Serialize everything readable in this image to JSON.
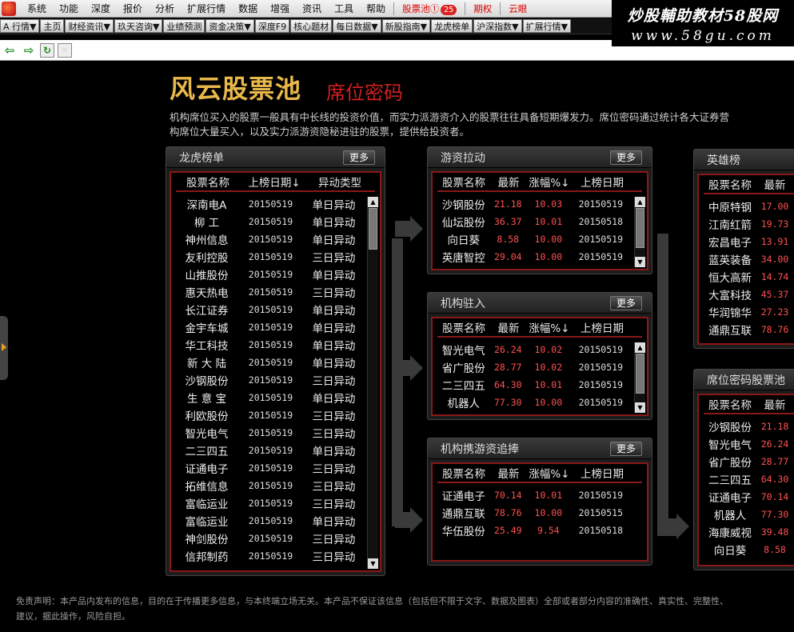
{
  "menubar": {
    "items": [
      "系统",
      "功能",
      "深度",
      "报价",
      "分析",
      "扩展行情",
      "数据",
      "增强",
      "资讯",
      "工具",
      "帮助"
    ],
    "stock_pool": "股票池",
    "stock_pool_num": "①",
    "stock_pool_badge": "25",
    "qiquan": "期权",
    "yunyan": "云眼"
  },
  "watermark": {
    "line1": "炒股輔助教材58股网",
    "line2": "www.58gu.com"
  },
  "tabs": [
    "A 行情▼",
    "主页",
    "财经资讯▼",
    "玖天咨询▼",
    "业绩预测",
    "资金决策▼",
    "深度F9",
    "核心题材",
    "每日数据▼",
    "新股指南▼",
    "龙虎榜单",
    "沪深指数▼",
    "扩展行情▼"
  ],
  "header": {
    "title": "风云股票池",
    "subtitle": "席位密码",
    "intro_line1": "机构席位买入的股票一般具有中长线的投资价值，而实力派游资介入的股票往往具备短期爆发力。席位密码通过统计各大证券营",
    "intro_line2": "构席位大量买入，以及实力派游资隐秘进驻的股票，提供给投资者。"
  },
  "more_label": "更多",
  "longhu": {
    "title": "龙虎榜单",
    "cols": [
      "股票名称",
      "上榜日期↓",
      "异动类型"
    ],
    "rows": [
      [
        "深南电A",
        "20150519",
        "单日异动"
      ],
      [
        "柳 工",
        "20150519",
        "单日异动"
      ],
      [
        "神州信息",
        "20150519",
        "单日异动"
      ],
      [
        "友利控股",
        "20150519",
        "三日异动"
      ],
      [
        "山推股份",
        "20150519",
        "单日异动"
      ],
      [
        "惠天热电",
        "20150519",
        "三日异动"
      ],
      [
        "长江证券",
        "20150519",
        "单日异动"
      ],
      [
        "金宇车城",
        "20150519",
        "单日异动"
      ],
      [
        "华工科技",
        "20150519",
        "单日异动"
      ],
      [
        "新 大 陆",
        "20150519",
        "单日异动"
      ],
      [
        "沙钢股份",
        "20150519",
        "三日异动"
      ],
      [
        "生 意 宝",
        "20150519",
        "单日异动"
      ],
      [
        "利欧股份",
        "20150519",
        "三日异动"
      ],
      [
        "智光电气",
        "20150519",
        "三日异动"
      ],
      [
        "二三四五",
        "20150519",
        "单日异动"
      ],
      [
        "证通电子",
        "20150519",
        "三日异动"
      ],
      [
        "拓维信息",
        "20150519",
        "三日异动"
      ],
      [
        "富临运业",
        "20150519",
        "三日异动"
      ],
      [
        "富临运业",
        "20150519",
        "单日异动"
      ],
      [
        "神剑股份",
        "20150519",
        "三日异动"
      ],
      [
        "信邦制药",
        "20150519",
        "三日异动"
      ]
    ]
  },
  "youzi": {
    "title": "游资拉动",
    "cols": [
      "股票名称",
      "最新",
      "涨幅%↓",
      "上榜日期"
    ],
    "rows": [
      [
        "沙钢股份",
        "21.18",
        "10.03",
        "20150519"
      ],
      [
        "仙坛股份",
        "36.37",
        "10.01",
        "20150518"
      ],
      [
        "向日葵",
        "8.58",
        "10.00",
        "20150519"
      ],
      [
        "英唐智控",
        "29.04",
        "10.00",
        "20150519"
      ]
    ]
  },
  "jigou": {
    "title": "机构驻入",
    "cols": [
      "股票名称",
      "最新",
      "涨幅%↓",
      "上榜日期"
    ],
    "rows": [
      [
        "智光电气",
        "26.24",
        "10.02",
        "20150519"
      ],
      [
        "省广股份",
        "28.77",
        "10.02",
        "20150519"
      ],
      [
        "二三四五",
        "64.30",
        "10.01",
        "20150519"
      ],
      [
        "机器人",
        "77.30",
        "10.00",
        "20150519"
      ]
    ]
  },
  "xieyou": {
    "title": "机构携游资追捧",
    "cols": [
      "股票名称",
      "最新",
      "涨幅%↓",
      "上榜日期"
    ],
    "rows": [
      [
        "证通电子",
        "70.14",
        "10.01",
        "20150519"
      ],
      [
        "通鼎互联",
        "78.76",
        "10.00",
        "20150515"
      ],
      [
        "华伍股份",
        "25.49",
        "9.54",
        "20150518"
      ]
    ]
  },
  "yingxiong": {
    "title": "英雄榜",
    "cols": [
      "股票名称",
      "最新"
    ],
    "rows": [
      [
        "中原特钢",
        "17.00"
      ],
      [
        "江南红箭",
        "19.73"
      ],
      [
        "宏昌电子",
        "13.91"
      ],
      [
        "蓝英装备",
        "34.00"
      ],
      [
        "恒大高新",
        "14.74"
      ],
      [
        "大富科技",
        "45.37"
      ],
      [
        "华润锦华",
        "27.23"
      ],
      [
        "通鼎互联",
        "78.76"
      ]
    ]
  },
  "xiwei": {
    "title": "席位密码股票池",
    "cols": [
      "股票名称",
      "最新"
    ],
    "rows": [
      [
        "沙钢股份",
        "21.18"
      ],
      [
        "智光电气",
        "26.24"
      ],
      [
        "省广股份",
        "28.77"
      ],
      [
        "二三四五",
        "64.30"
      ],
      [
        "证通电子",
        "70.14"
      ],
      [
        "机器人",
        "77.30"
      ],
      [
        "海康威视",
        "39.48"
      ],
      [
        "向日葵",
        "8.58"
      ]
    ]
  },
  "footer": {
    "line1": "免责声明：本产品内发布的信息，目的在于传播更多信息，与本终端立场无关。本产品不保证该信息（包括但不限于文字、数据及图表）全部或者部分内容的准确性、真实性、完整性、",
    "line2": "建议，据此操作，风险自担。"
  }
}
